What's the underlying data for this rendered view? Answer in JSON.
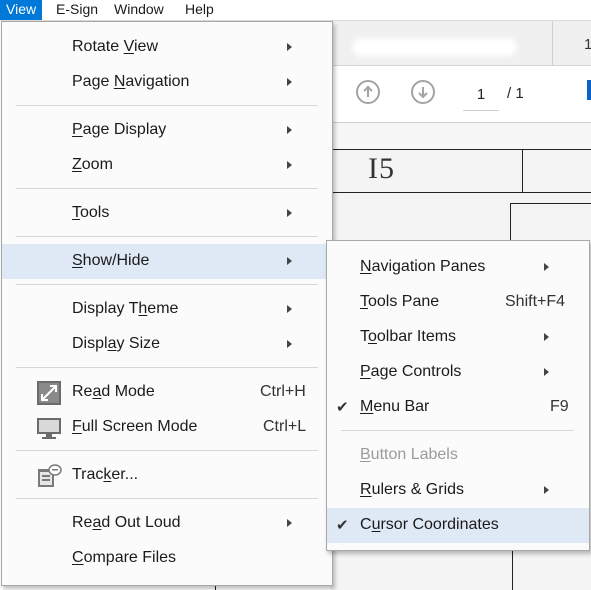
{
  "menubar": {
    "items": [
      {
        "label": "View",
        "active": true
      },
      {
        "label": "E-Sign",
        "active": false
      },
      {
        "label": "Window",
        "active": false
      },
      {
        "label": "Help",
        "active": false
      }
    ]
  },
  "background": {
    "tab_number": "1",
    "page_current": "1",
    "page_total": "/ 1",
    "doc_text": "I5"
  },
  "view_menu": {
    "items": [
      {
        "pre": "Rotate ",
        "mn": "V",
        "post": "iew",
        "submenu": true
      },
      {
        "pre": "Page ",
        "mn": "N",
        "post": "avigation",
        "submenu": true
      },
      {
        "pre": "",
        "mn": "P",
        "post": "age Display",
        "submenu": true
      },
      {
        "pre": "",
        "mn": "Z",
        "post": "oom",
        "submenu": true
      },
      {
        "pre": "",
        "mn": "T",
        "post": "ools",
        "submenu": true
      },
      {
        "pre": "",
        "mn": "S",
        "post": "how/Hide",
        "submenu": true,
        "highlighted": true
      },
      {
        "pre": "Display T",
        "mn": "h",
        "post": "eme",
        "submenu": true
      },
      {
        "pre": "Displ",
        "mn": "a",
        "post": "y Size",
        "submenu": true
      },
      {
        "pre": "Re",
        "mn": "a",
        "post": "d Mode",
        "shortcut": "Ctrl+H",
        "icon": "read-mode-icon"
      },
      {
        "pre": "",
        "mn": "F",
        "post": "ull Screen Mode",
        "shortcut": "Ctrl+L",
        "icon": "full-screen-icon"
      },
      {
        "pre": "Trac",
        "mn": "k",
        "post": "er...",
        "icon": "tracker-icon"
      },
      {
        "pre": "Re",
        "mn": "a",
        "post": "d Out Loud",
        "submenu": true
      },
      {
        "pre": "",
        "mn": "C",
        "post": "ompare Files"
      }
    ]
  },
  "show_hide_menu": {
    "items": [
      {
        "pre": "",
        "mn": "N",
        "post": "avigation Panes",
        "submenu": true
      },
      {
        "pre": "",
        "mn": "T",
        "post": "ools Pane",
        "shortcut": "Shift+F4"
      },
      {
        "pre": "T",
        "mn": "o",
        "post": "olbar Items",
        "submenu": true
      },
      {
        "pre": "",
        "mn": "P",
        "post": "age Controls",
        "submenu": true
      },
      {
        "pre": "",
        "mn": "M",
        "post": "enu Bar",
        "shortcut": "F9",
        "checked": true
      },
      {
        "pre": "",
        "mn": "B",
        "post": "utton Labels",
        "disabled": true
      },
      {
        "pre": "",
        "mn": "R",
        "post": "ulers & Grids",
        "submenu": true
      },
      {
        "pre": "C",
        "mn": "u",
        "post": "rsor Coordinates",
        "checked": true,
        "highlighted": true
      }
    ]
  },
  "colors": {
    "accent": "#0078d7",
    "highlight": "#dfe8f5"
  }
}
